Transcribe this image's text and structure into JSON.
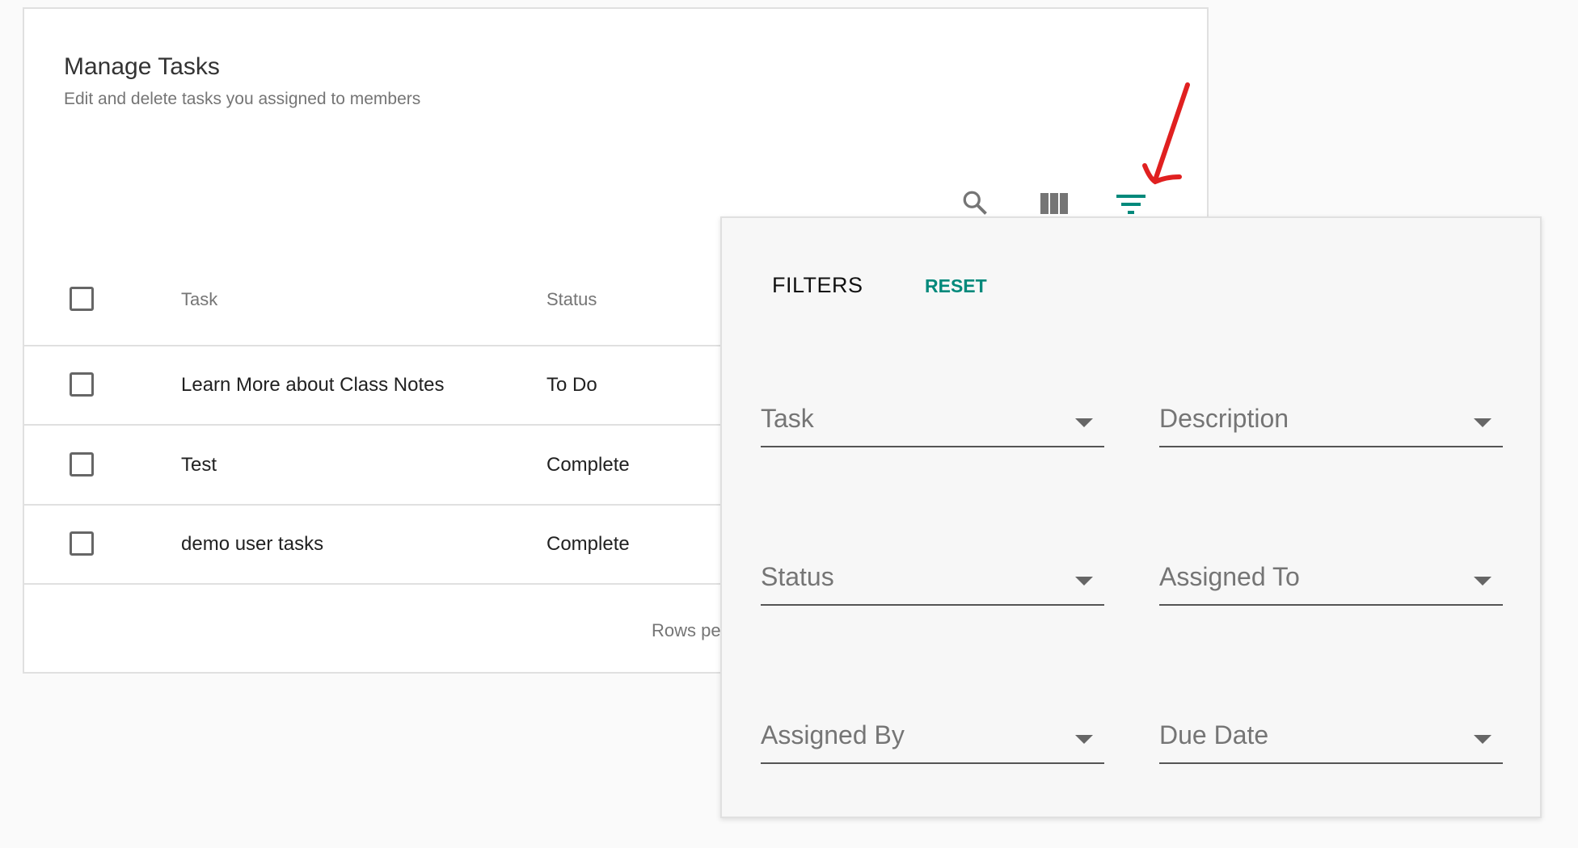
{
  "header": {
    "title": "Manage Tasks",
    "subtitle": "Edit and delete tasks you assigned to members"
  },
  "toolbar": {
    "icons": [
      "search-icon",
      "view-columns-icon",
      "filter-icon"
    ],
    "active_color": "#00897b"
  },
  "table": {
    "columns": [
      "Task",
      "Status"
    ],
    "rows": [
      {
        "task": "Learn More about Class Notes",
        "status": "To Do"
      },
      {
        "task": "Test",
        "status": "Complete"
      },
      {
        "task": "demo user tasks",
        "status": "Complete"
      }
    ],
    "footer": {
      "rows_per_page": "Rows pe"
    }
  },
  "filters": {
    "title": "FILTERS",
    "reset": "RESET",
    "fields": [
      "Task",
      "Description",
      "Status",
      "Assigned To",
      "Assigned By",
      "Due Date"
    ]
  },
  "annotation": {
    "color": "#e02020"
  }
}
